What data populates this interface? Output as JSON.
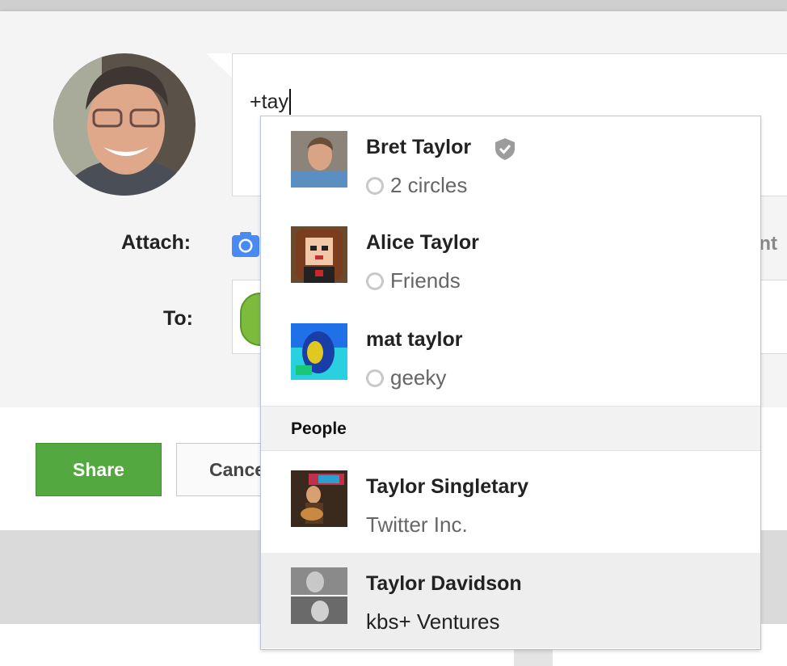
{
  "composer": {
    "input_text": "+tay"
  },
  "labels": {
    "attach": "Attach:",
    "to": "To:",
    "attach_partial": "ent"
  },
  "buttons": {
    "share": "Share",
    "cancel": "Cance"
  },
  "suggestions": {
    "circles": [
      {
        "name": "Bret Taylor",
        "detail": "2 circles",
        "verified": true
      },
      {
        "name": "Alice Taylor",
        "detail": "Friends"
      },
      {
        "name": "mat taylor",
        "detail": "geeky"
      }
    ],
    "people_header": "People",
    "people": [
      {
        "name": "Taylor Singletary",
        "detail": "Twitter Inc."
      },
      {
        "name": "Taylor Davidson",
        "detail": "kbs+ Ventures"
      }
    ]
  },
  "colors": {
    "share_button": "#53a93f",
    "dropdown_border": "#b9c4d6",
    "highlight_row": "#eeeeee",
    "camera_icon": "#4a8af4"
  }
}
